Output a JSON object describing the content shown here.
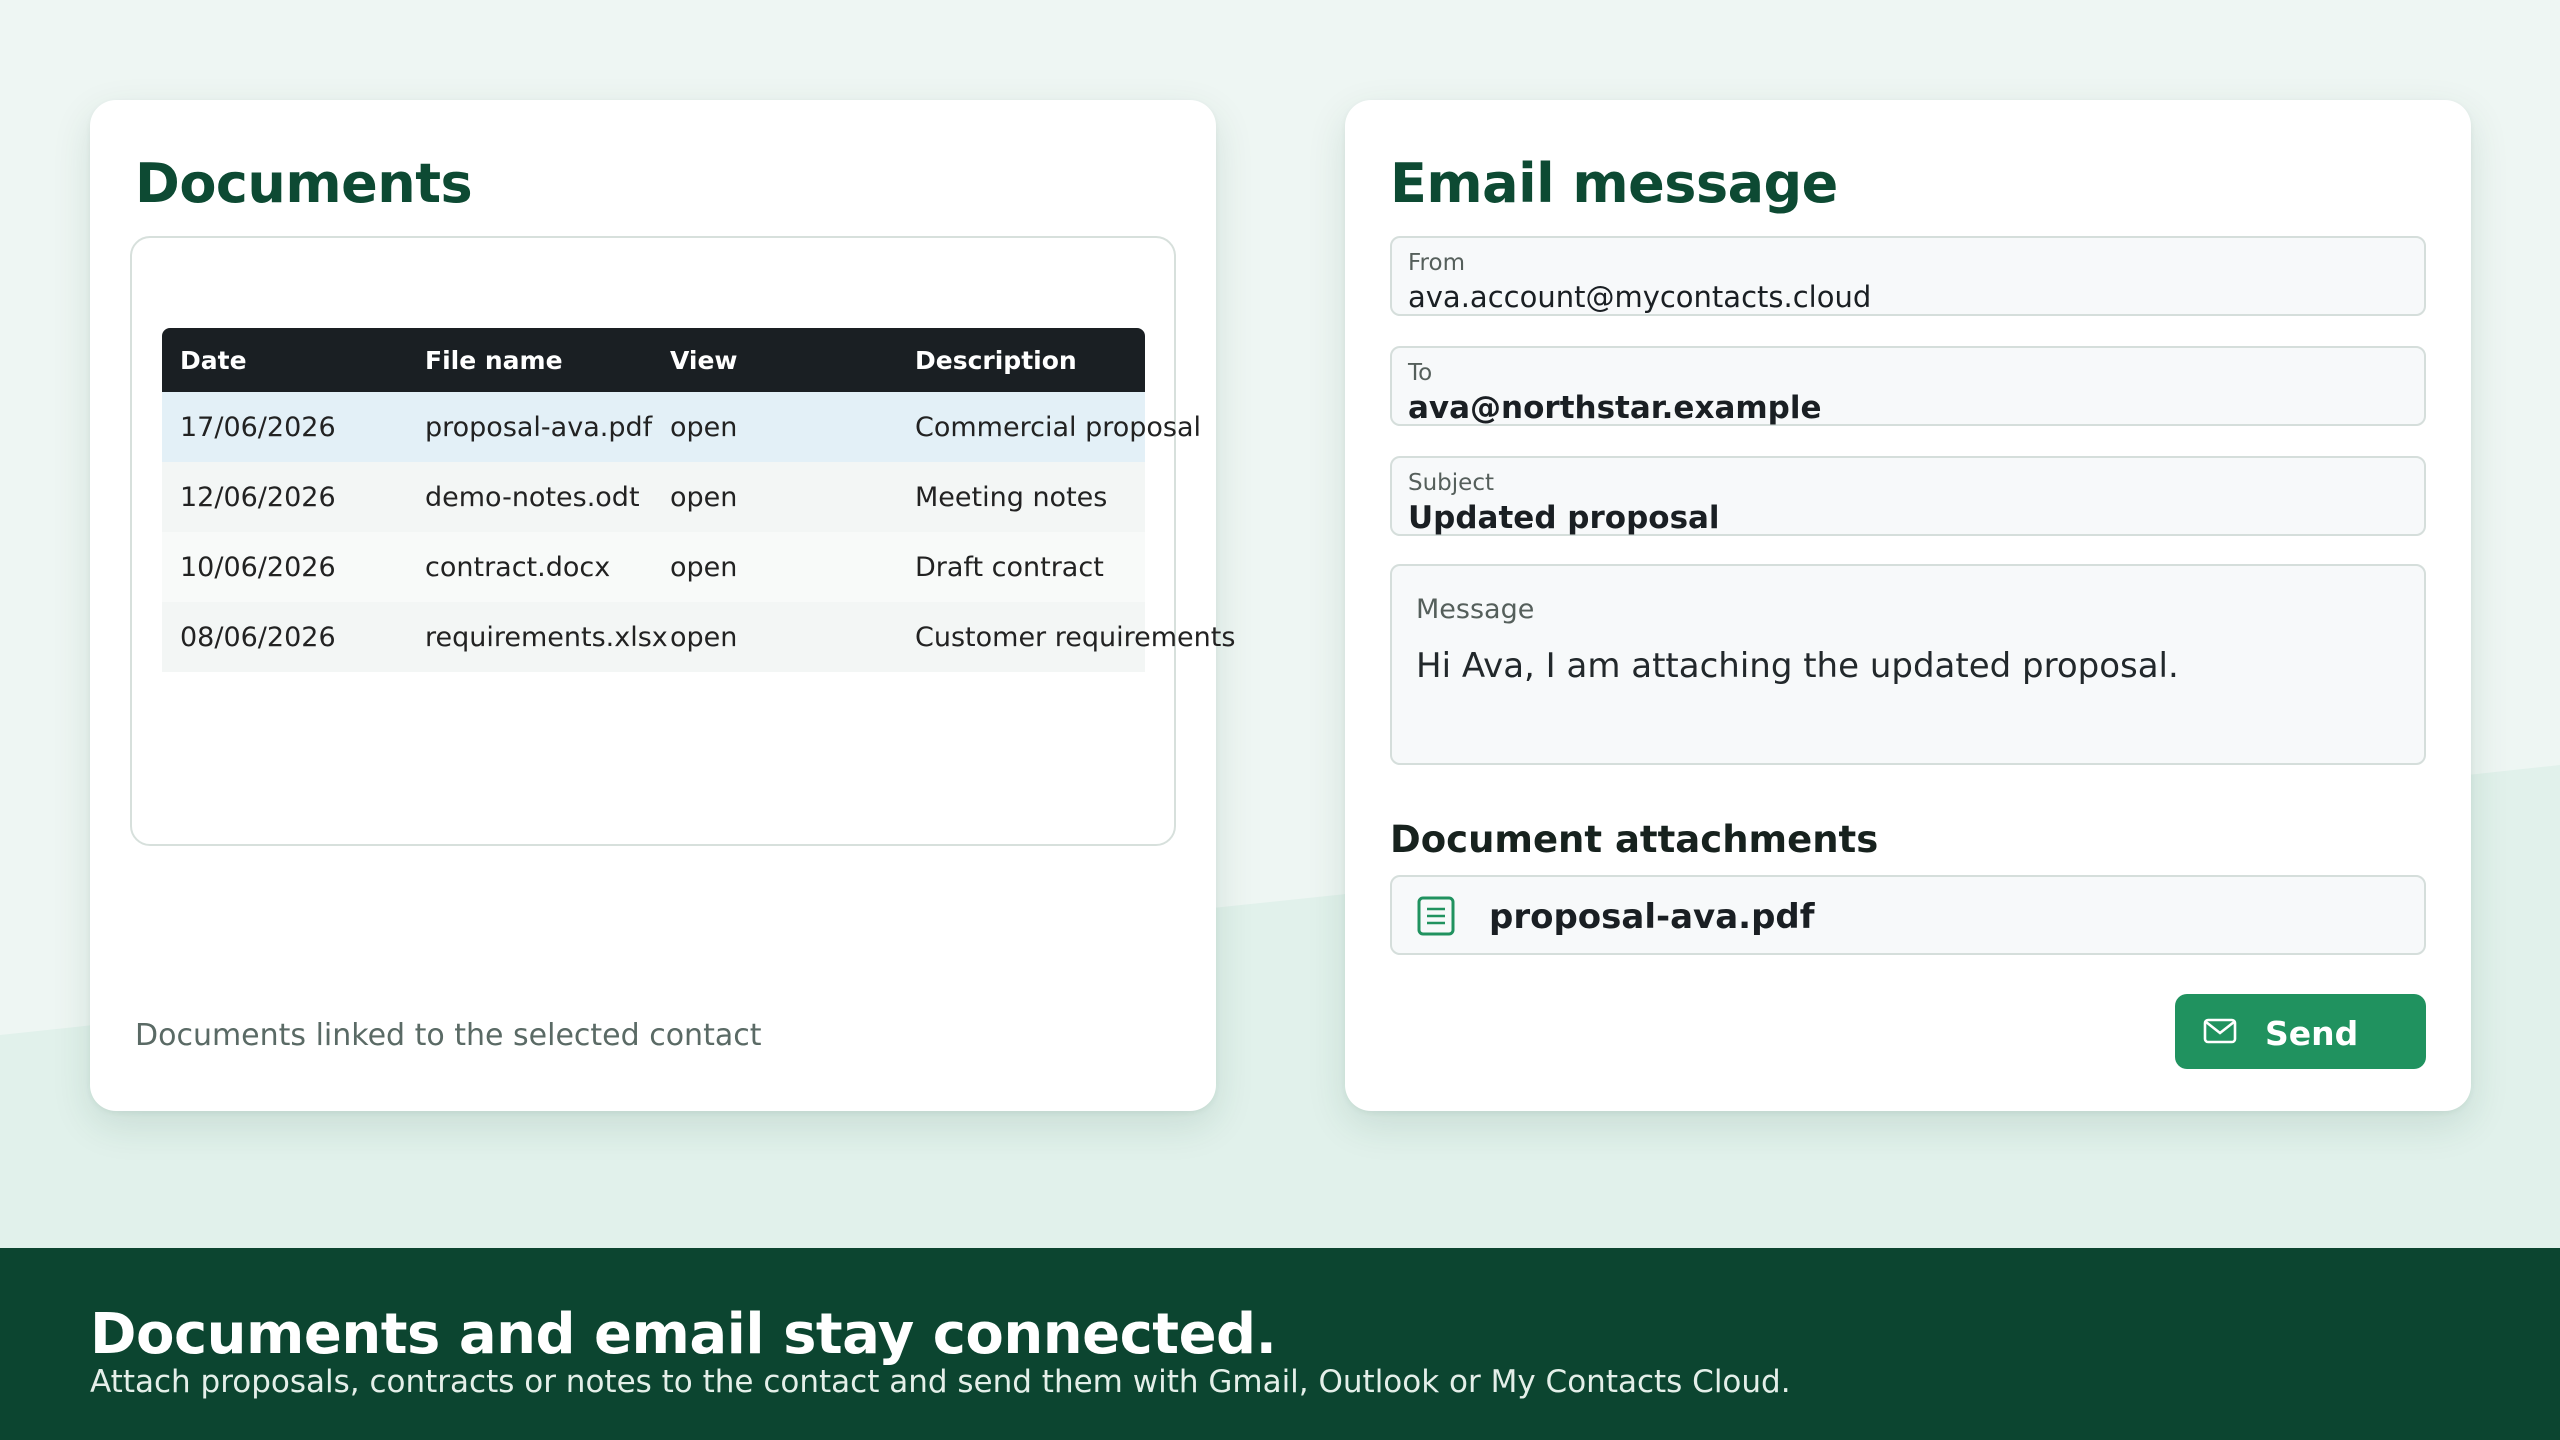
{
  "documents": {
    "title": "Documents",
    "columns": [
      "Date",
      "File name",
      "View",
      "Description"
    ],
    "rows": [
      {
        "date": "17/06/2026",
        "file": "proposal-ava.pdf",
        "view": "open",
        "description": "Commercial proposal"
      },
      {
        "date": "12/06/2026",
        "file": "demo-notes.odt",
        "view": "open",
        "description": "Meeting notes"
      },
      {
        "date": "10/06/2026",
        "file": "contract.docx",
        "view": "open",
        "description": "Draft contract"
      },
      {
        "date": "08/06/2026",
        "file": "requirements.xlsx",
        "view": "open",
        "description": "Customer requirements"
      }
    ],
    "footnote": "Documents linked to the selected contact"
  },
  "email": {
    "title": "Email message",
    "from": {
      "label": "From",
      "value": "ava.account@mycontacts.cloud"
    },
    "to": {
      "label": "To",
      "value": "ava@northstar.example"
    },
    "subject": {
      "label": "Subject",
      "value": "Updated proposal"
    },
    "message": {
      "label": "Message",
      "value": "Hi Ava, I am attaching the updated proposal."
    },
    "attachments_title": "Document attachments",
    "attachment": {
      "name": "proposal-ava.pdf",
      "icon": "document-icon"
    },
    "send": {
      "label": "Send",
      "icon": "mail-icon"
    }
  },
  "banner": {
    "title": "Documents and email stay connected.",
    "subtitle": "Attach proposals, contracts or notes to the contact and send them with Gmail, Outlook or My Contacts Cloud."
  },
  "colors": {
    "brand_dark": "#0c4530",
    "title_green": "#0d4a33",
    "send_green": "#20925f",
    "table_header": "#1a1f23",
    "selected_row": "#e3f0f7",
    "background": "#eef6f3"
  }
}
